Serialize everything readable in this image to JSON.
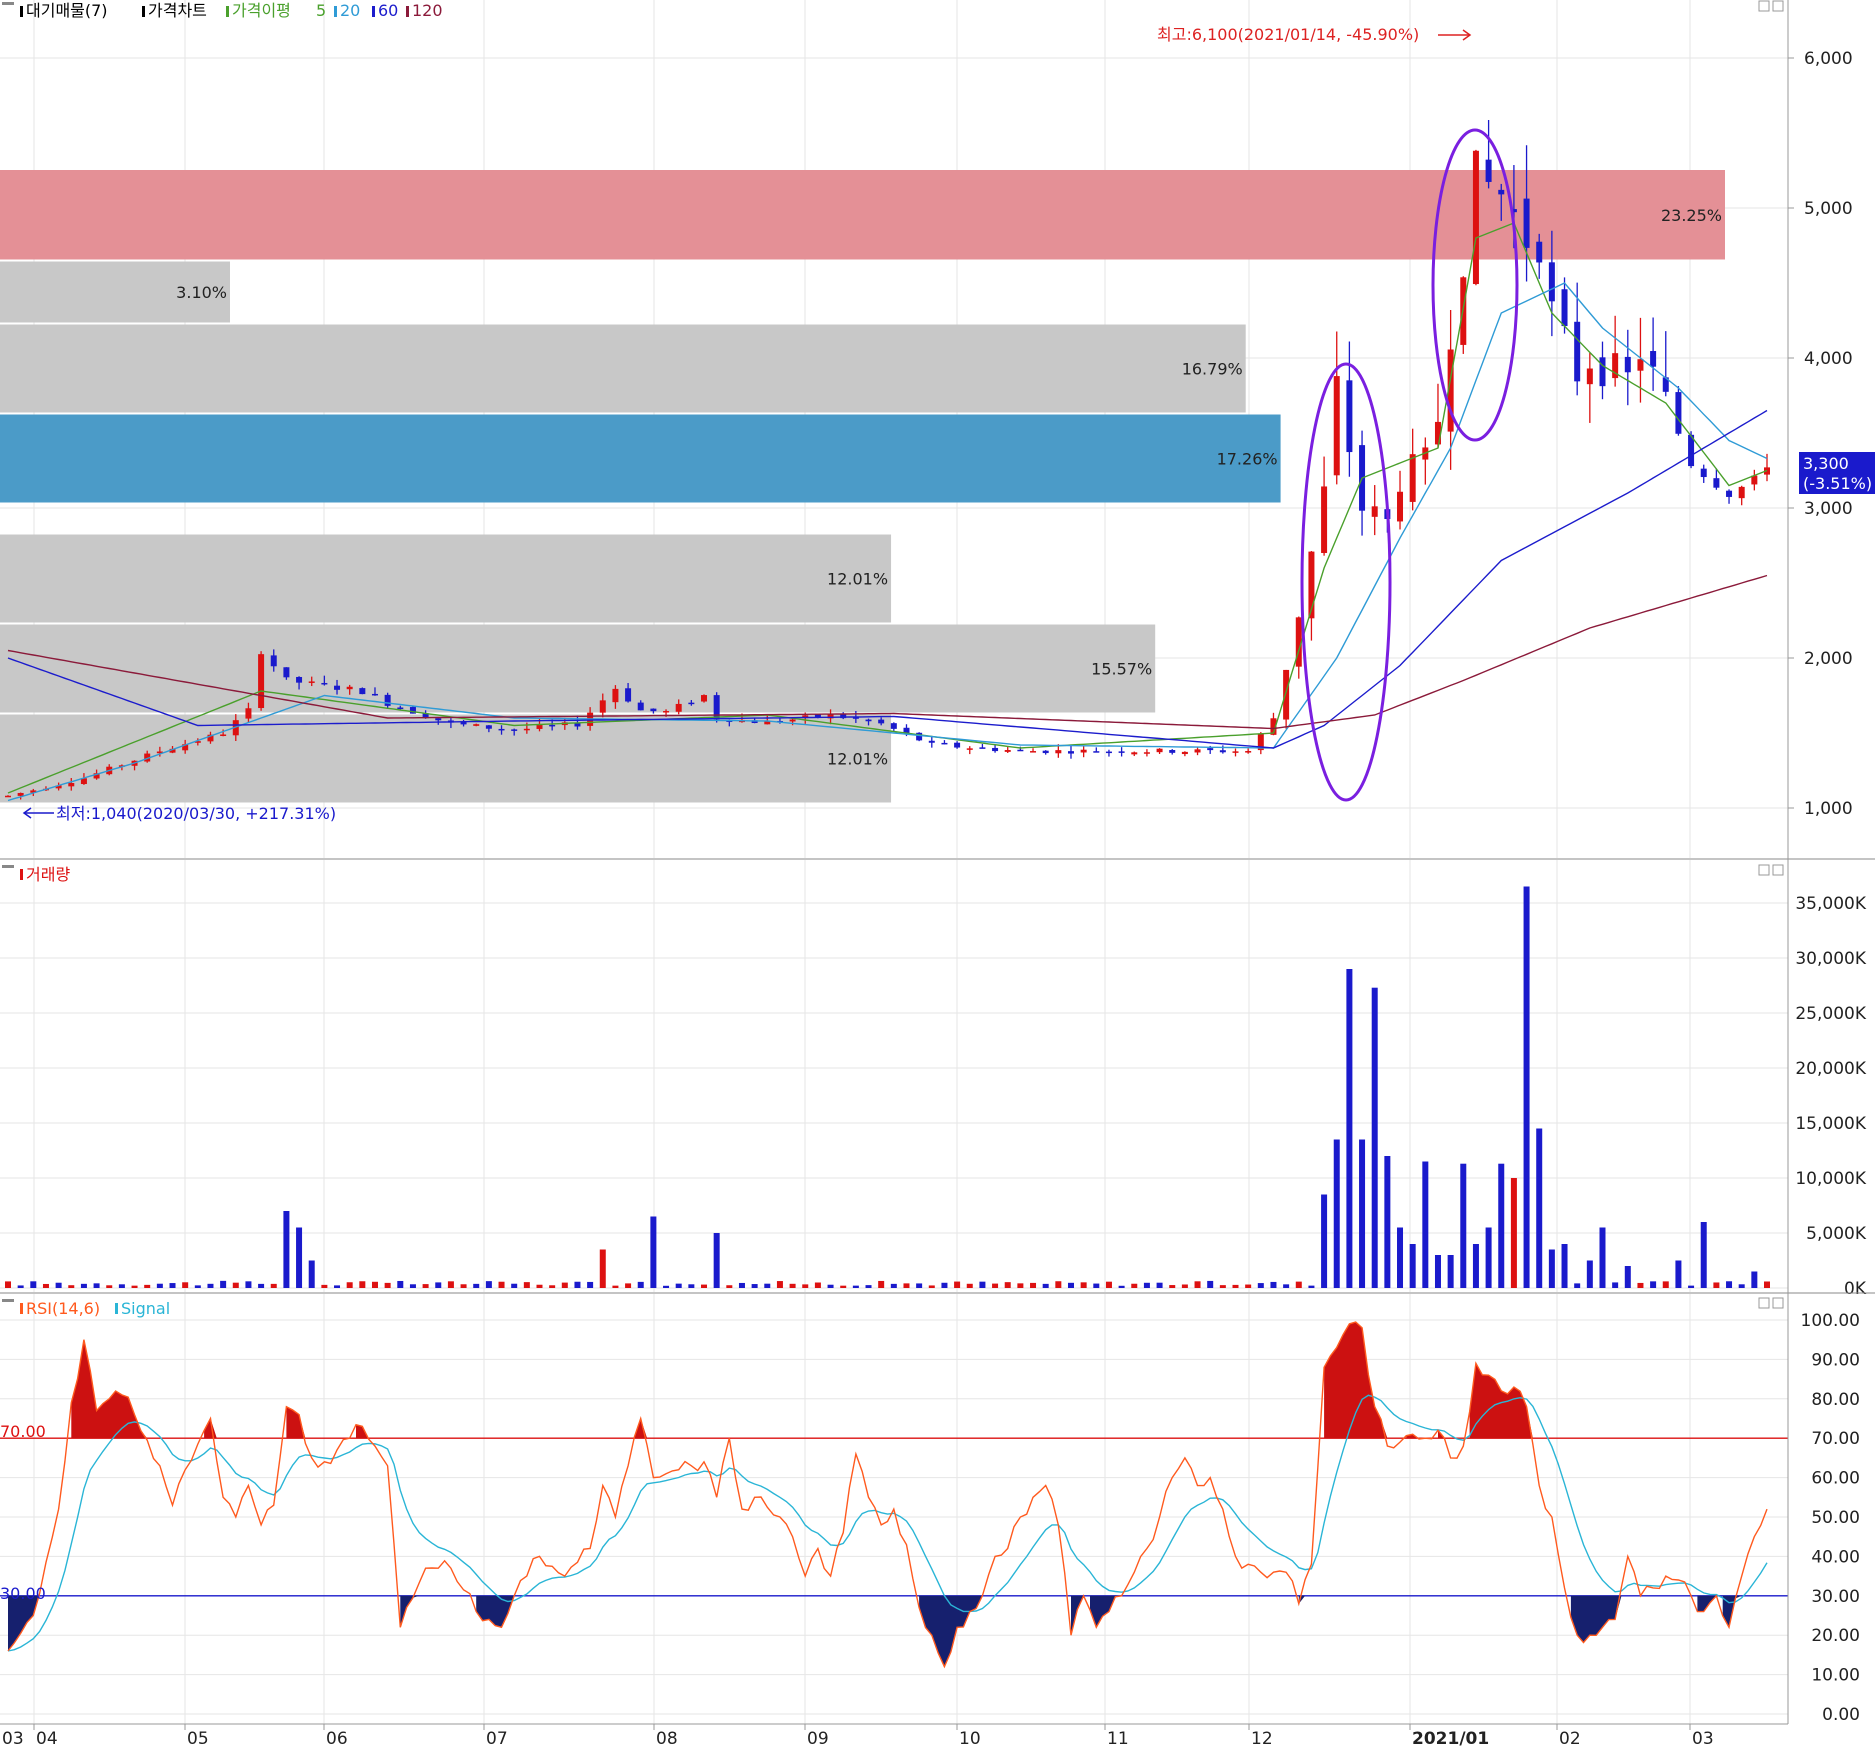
{
  "legend": {
    "volume_profile": "대기매물(7)",
    "price_chart": "가격차트",
    "ma_label": "가격이평",
    "ma_periods": [
      "5",
      "20",
      "60",
      "120"
    ],
    "ma_colors": [
      "#4aa02c",
      "#2f9bd6",
      "#1c1ccc",
      "#8b1a3a"
    ]
  },
  "colors": {
    "up": "#dd1111",
    "down": "#1a1acc",
    "highlight_band": "#e49096",
    "current_band": "#4b9bc8",
    "band": "#c8c8c8",
    "annotation": "#7a1fe0"
  },
  "price_axis": {
    "ticks": [
      "6,000",
      "5,000",
      "4,000",
      "3,000",
      "2,000",
      "1,000"
    ]
  },
  "current_price": {
    "value": "3,300",
    "change": "(-3.51%)"
  },
  "annotations": {
    "high": "최고:6,100(2021/01/14, -45.90%)",
    "low": "최저:1,040(2020/03/30, +217.31%)"
  },
  "volume_panel": {
    "title": "거래량",
    "ticks": [
      "35,000K",
      "30,000K",
      "25,000K",
      "20,000K",
      "15,000K",
      "10,000K",
      "5,000K",
      "0K"
    ]
  },
  "rsi_panel": {
    "title": "RSI(14,6)",
    "signal": "Signal",
    "ticks": [
      "100.00",
      "90.00",
      "80.00",
      "70.00",
      "60.00",
      "50.00",
      "40.00",
      "30.00",
      "20.00",
      "10.00",
      "0.00"
    ],
    "upper_label": "70.00",
    "lower_label": "30.00"
  },
  "x_axis": {
    "labels": [
      "03",
      "04",
      "05",
      "06",
      "07",
      "08",
      "09",
      "10",
      "11",
      "12",
      "2021/01",
      "02",
      "03"
    ]
  },
  "chart_data": {
    "type": "candlestick",
    "price_range": [
      700,
      6400
    ],
    "volume_profile": [
      {
        "low": 4650,
        "high": 5260,
        "pct": "23.25%",
        "highlight": true
      },
      {
        "low": 3030,
        "high": 3630,
        "pct": "17.26%",
        "current": true
      },
      {
        "low": 3630,
        "high": 4230,
        "pct": "16.79%"
      },
      {
        "low": 1630,
        "high": 2230,
        "pct": "15.57%"
      },
      {
        "low": 2230,
        "high": 2830,
        "pct": "12.01%"
      },
      {
        "low": 1030,
        "high": 1630,
        "pct": "12.01%"
      },
      {
        "low": 4230,
        "high": 4650,
        "pct": "3.10%"
      }
    ],
    "price_path": [
      [
        0,
        1080
      ],
      [
        6,
        1200
      ],
      [
        12,
        1380
      ],
      [
        17,
        1500
      ],
      [
        19,
        1650
      ],
      [
        20,
        2050
      ],
      [
        22,
        1850
      ],
      [
        28,
        1780
      ],
      [
        30,
        1700
      ],
      [
        35,
        1560
      ],
      [
        40,
        1520
      ],
      [
        45,
        1560
      ],
      [
        48,
        1800
      ],
      [
        50,
        1650
      ],
      [
        52,
        1640
      ],
      [
        55,
        1750
      ],
      [
        56,
        1600
      ],
      [
        60,
        1570
      ],
      [
        65,
        1620
      ],
      [
        69,
        1560
      ],
      [
        73,
        1420
      ],
      [
        80,
        1380
      ],
      [
        90,
        1380
      ],
      [
        98,
        1380
      ],
      [
        100,
        1600
      ],
      [
        102,
        2300
      ],
      [
        104,
        3100
      ],
      [
        105,
        3800
      ],
      [
        107,
        3000
      ],
      [
        109,
        2900
      ],
      [
        110,
        3200
      ],
      [
        112,
        3300
      ],
      [
        113,
        3600
      ],
      [
        114,
        4200
      ],
      [
        116,
        5200
      ],
      [
        118,
        5100
      ],
      [
        120,
        4800
      ],
      [
        121,
        4800
      ],
      [
        122,
        4300
      ],
      [
        124,
        3900
      ],
      [
        125,
        4000
      ],
      [
        128,
        3850
      ],
      [
        129,
        4050
      ],
      [
        131,
        3700
      ],
      [
        133,
        3300
      ],
      [
        136,
        3100
      ],
      [
        138,
        3180
      ],
      [
        139,
        3300
      ]
    ],
    "ma_series": [
      {
        "period": "5",
        "points": [
          [
            0,
            1100
          ],
          [
            20,
            1780
          ],
          [
            40,
            1550
          ],
          [
            60,
            1620
          ],
          [
            80,
            1400
          ],
          [
            100,
            1500
          ],
          [
            104,
            2600
          ],
          [
            107,
            3200
          ],
          [
            113,
            3400
          ],
          [
            116,
            4800
          ],
          [
            119,
            4900
          ],
          [
            122,
            4300
          ],
          [
            126,
            3950
          ],
          [
            131,
            3700
          ],
          [
            136,
            3150
          ],
          [
            139,
            3250
          ]
        ]
      },
      {
        "period": "20",
        "points": [
          [
            0,
            1050
          ],
          [
            10,
            1300
          ],
          [
            25,
            1750
          ],
          [
            40,
            1600
          ],
          [
            60,
            1580
          ],
          [
            80,
            1420
          ],
          [
            100,
            1400
          ],
          [
            105,
            2000
          ],
          [
            110,
            2800
          ],
          [
            114,
            3400
          ],
          [
            118,
            4300
          ],
          [
            123,
            4500
          ],
          [
            126,
            4200
          ],
          [
            132,
            3800
          ],
          [
            136,
            3450
          ],
          [
            139,
            3330
          ]
        ]
      },
      {
        "period": "60",
        "points": [
          [
            0,
            2000
          ],
          [
            15,
            1550
          ],
          [
            40,
            1580
          ],
          [
            70,
            1610
          ],
          [
            100,
            1400
          ],
          [
            104,
            1550
          ],
          [
            110,
            1950
          ],
          [
            118,
            2650
          ],
          [
            128,
            3100
          ],
          [
            135,
            3450
          ],
          [
            139,
            3650
          ]
        ]
      },
      {
        "period": "120",
        "points": [
          [
            0,
            2050
          ],
          [
            30,
            1600
          ],
          [
            70,
            1630
          ],
          [
            100,
            1530
          ],
          [
            108,
            1620
          ],
          [
            115,
            1850
          ],
          [
            125,
            2200
          ],
          [
            135,
            2450
          ],
          [
            139,
            2550
          ]
        ]
      }
    ],
    "volume_events": [
      [
        22,
        7000
      ],
      [
        23,
        5500
      ],
      [
        24,
        2500
      ],
      [
        47,
        3500
      ],
      [
        51,
        6500
      ],
      [
        56,
        5000
      ],
      [
        104,
        8500
      ],
      [
        105,
        13500
      ],
      [
        106,
        29000
      ],
      [
        107,
        13500
      ],
      [
        108,
        27300
      ],
      [
        109,
        12000
      ],
      [
        110,
        5500
      ],
      [
        111,
        4000
      ],
      [
        112,
        11500
      ],
      [
        113,
        3000
      ],
      [
        114,
        3000
      ],
      [
        115,
        11300
      ],
      [
        116,
        4000
      ],
      [
        117,
        5500
      ],
      [
        118,
        11300
      ],
      [
        119,
        10000
      ],
      [
        120,
        36500
      ],
      [
        121,
        14500
      ],
      [
        122,
        3500
      ],
      [
        123,
        4000
      ],
      [
        125,
        2500
      ],
      [
        126,
        5500
      ],
      [
        128,
        2000
      ],
      [
        132,
        2500
      ],
      [
        134,
        6000
      ],
      [
        138,
        1500
      ]
    ],
    "rsi_path": [
      [
        0,
        16
      ],
      [
        2,
        25
      ],
      [
        4,
        52
      ],
      [
        5,
        79
      ],
      [
        6,
        95
      ],
      [
        7,
        77
      ],
      [
        8,
        80
      ],
      [
        9,
        81
      ],
      [
        10,
        76
      ],
      [
        12,
        63
      ],
      [
        13,
        53
      ],
      [
        14,
        62
      ],
      [
        16,
        75
      ],
      [
        17,
        55
      ],
      [
        18,
        50
      ],
      [
        19,
        58
      ],
      [
        20,
        48
      ],
      [
        21,
        53
      ],
      [
        22,
        78
      ],
      [
        23,
        76
      ],
      [
        24,
        65
      ],
      [
        25,
        64
      ],
      [
        27,
        70
      ],
      [
        28,
        73
      ],
      [
        30,
        63
      ],
      [
        31,
        22
      ],
      [
        33,
        37
      ],
      [
        35,
        37
      ],
      [
        37,
        26
      ],
      [
        39,
        22
      ],
      [
        40,
        30
      ],
      [
        42,
        40
      ],
      [
        44,
        35
      ],
      [
        46,
        42
      ],
      [
        47,
        58
      ],
      [
        48,
        50
      ],
      [
        49,
        63
      ],
      [
        50,
        75
      ],
      [
        51,
        60
      ],
      [
        53,
        62
      ],
      [
        55,
        64
      ],
      [
        56,
        55
      ],
      [
        57,
        70
      ],
      [
        58,
        52
      ],
      [
        59,
        55
      ],
      [
        61,
        50
      ],
      [
        62,
        45
      ],
      [
        63,
        35
      ],
      [
        64,
        42
      ],
      [
        65,
        35
      ],
      [
        66,
        46
      ],
      [
        67,
        66
      ],
      [
        68,
        55
      ],
      [
        69,
        48
      ],
      [
        70,
        52
      ],
      [
        71,
        43
      ],
      [
        72,
        27
      ],
      [
        73,
        20
      ],
      [
        74,
        12
      ],
      [
        75,
        22
      ],
      [
        77,
        30
      ],
      [
        78,
        40
      ],
      [
        79,
        42
      ],
      [
        80,
        50
      ],
      [
        81,
        55
      ],
      [
        82,
        58
      ],
      [
        83,
        48
      ],
      [
        84,
        20
      ],
      [
        85,
        30
      ],
      [
        86,
        22
      ],
      [
        88,
        30
      ],
      [
        90,
        42
      ],
      [
        91,
        50
      ],
      [
        92,
        60
      ],
      [
        93,
        65
      ],
      [
        94,
        58
      ],
      [
        95,
        60
      ],
      [
        96,
        52
      ],
      [
        97,
        40
      ],
      [
        99,
        36
      ],
      [
        101,
        36
      ],
      [
        102,
        28
      ],
      [
        103,
        38
      ],
      [
        104,
        88
      ],
      [
        105,
        93
      ],
      [
        106,
        99
      ],
      [
        107,
        98
      ],
      [
        108,
        78
      ],
      [
        109,
        68
      ],
      [
        110,
        69
      ],
      [
        111,
        71
      ],
      [
        112,
        70
      ],
      [
        113,
        72
      ],
      [
        114,
        65
      ],
      [
        115,
        68
      ],
      [
        116,
        89
      ],
      [
        117,
        86
      ],
      [
        118,
        82
      ],
      [
        119,
        83
      ],
      [
        120,
        78
      ],
      [
        121,
        58
      ],
      [
        122,
        50
      ],
      [
        123,
        32
      ],
      [
        124,
        20
      ],
      [
        125,
        20
      ],
      [
        126,
        22
      ],
      [
        127,
        24
      ],
      [
        128,
        40
      ],
      [
        129,
        30
      ],
      [
        130,
        32
      ],
      [
        131,
        35
      ],
      [
        132,
        34
      ],
      [
        133,
        30
      ],
      [
        134,
        26
      ],
      [
        135,
        30
      ],
      [
        136,
        22
      ],
      [
        137,
        35
      ],
      [
        138,
        45
      ],
      [
        139,
        52
      ]
    ],
    "rsi_levels": {
      "upper": 70,
      "lower": 30,
      "range": [
        0,
        100
      ]
    }
  }
}
